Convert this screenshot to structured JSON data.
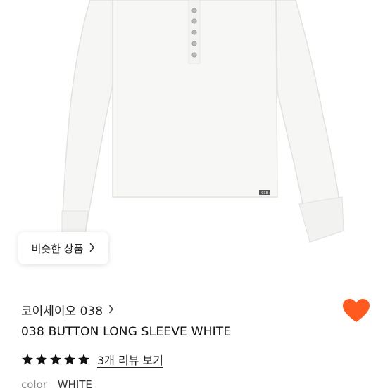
{
  "product": {
    "similar_button_label": "비슷한 상품",
    "brand": "코이세이오 038",
    "title": "038 BUTTON LONG SLEEVE WHITE",
    "rating": 5,
    "rating_max": 5,
    "review_link": "3개 리뷰 보기",
    "color_label": "color",
    "color_value": "WHITE",
    "shirt_tag": "038",
    "wishlisted": true
  },
  "colors": {
    "heart": "#ff5a1f",
    "star": "#111111",
    "shirt": "#f6f6f4"
  },
  "icons": {
    "similar_chevron": "chevron-right-icon",
    "brand_chevron": "chevron-right-icon",
    "heart": "heart-icon",
    "star": "star-icon"
  }
}
